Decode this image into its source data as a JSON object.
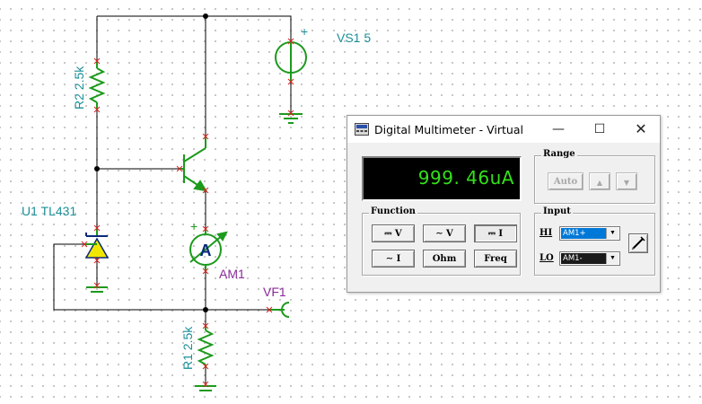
{
  "schematic": {
    "labels": {
      "vs1": "VS1 5",
      "r2": "R2 2.5k",
      "u1": "U1 TL431",
      "am1": "AM1",
      "vf1": "VF1",
      "r1": "R1 2.5k",
      "ammeter_symbol": "A",
      "vs1_plus": "+",
      "am1_plus": "+"
    }
  },
  "multimeter": {
    "title": "Digital Multimeter - Virtual",
    "window_buttons": {
      "minimize": "—",
      "maximize": "☐",
      "close": "✕"
    },
    "display_value": "999. 46uA",
    "range": {
      "label": "Range",
      "auto_label": "Auto",
      "up_label": "▲",
      "down_label": "▼"
    },
    "function": {
      "label": "Function",
      "buttons": [
        {
          "label": "⎓ V"
        },
        {
          "label": "∼ V"
        },
        {
          "label": "⎓ I",
          "pressed": true
        },
        {
          "label": "∼ I"
        },
        {
          "label": "Ohm"
        },
        {
          "label": "Freq"
        }
      ]
    },
    "input": {
      "label": "Input",
      "hi_label": "HI",
      "hi_value": "AM1+",
      "lo_label": "LO",
      "lo_value": "AM1-"
    },
    "colors": {
      "display_text": "#33e11a",
      "hi_bg": "#0078d7",
      "lo_bg": "#1a1a1a",
      "wire": "#000000",
      "component": "#1c9a1c"
    }
  }
}
